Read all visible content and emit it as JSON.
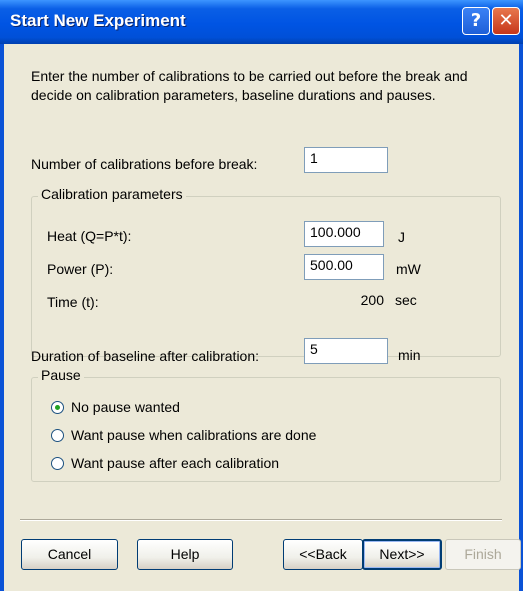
{
  "window": {
    "title": "Start New Experiment",
    "help_glyph": "?",
    "close_glyph": "✕"
  },
  "intro_text": "Enter the number of calibrations to be carried out before the break and decide on calibration parameters, baseline durations and pauses.",
  "calibrations": {
    "label": "Number of calibrations before break:",
    "value": "1"
  },
  "calibration_parameters": {
    "legend": "Calibration parameters",
    "heat": {
      "label": "Heat (Q=P*t):",
      "value": "100.000",
      "unit": "J"
    },
    "power": {
      "label": "Power (P):",
      "value": "500.00",
      "unit": "mW"
    },
    "time": {
      "label": "Time (t):",
      "value": "200",
      "unit": "sec"
    }
  },
  "baseline": {
    "label": "Duration of baseline after calibration:",
    "value": "5",
    "unit": "min"
  },
  "pause": {
    "legend": "Pause",
    "options": [
      {
        "label": "No pause wanted",
        "selected": true
      },
      {
        "label": "Want pause when calibrations are done",
        "selected": false
      },
      {
        "label": "Want pause after each calibration",
        "selected": false
      }
    ]
  },
  "buttons": {
    "cancel": "Cancel",
    "help": "Help",
    "back": "<<Back",
    "next": "Next>>",
    "finish": "Finish"
  },
  "colors": {
    "title_bar": "#0054E3",
    "dialog_background": "#ECE9D8",
    "radio_selected": "#21A121",
    "disabled_text": "#ACA899"
  }
}
